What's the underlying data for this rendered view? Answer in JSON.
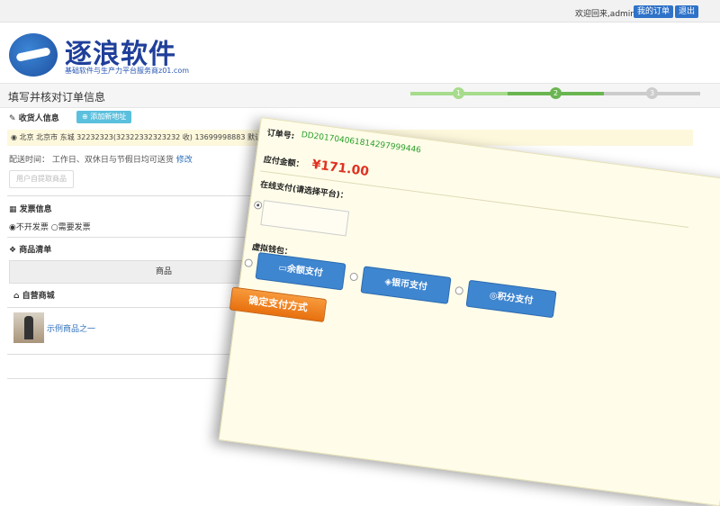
{
  "header": {
    "welcome": "欢迎回来,admin",
    "my_orders": "我的订单",
    "logout": "退出"
  },
  "logo": {
    "title": "逐浪软件",
    "subtitle": "基础软件与生产力平台服务商z01.com"
  },
  "page_title": "填写并核对订单信息",
  "steps": [
    "1",
    "2",
    "3"
  ],
  "consignee": {
    "heading": "收货人信息",
    "add_address": "添加新地址",
    "address_line": "北京 北京市 东城 32232323(32322332323232 收) 13699998883 默认地址",
    "shipping_label": "配送时间：",
    "shipping_value": "工作日、双休日与节假日均可送货",
    "shipping_edit": "修改",
    "pickup": "用户自提取商品"
  },
  "invoice": {
    "heading": "发票信息",
    "opt_no": "不开发票",
    "opt_yes": "需要发票"
  },
  "products": {
    "heading": "商品清单",
    "col_product": "商品",
    "shop": "自营商城",
    "item_name": "示例商品之一"
  },
  "payment": {
    "order_no_label": "订单号:",
    "order_no": "DD20170406181429799944​6",
    "amount_label": "应付金额：",
    "amount": "¥171.00",
    "online_label": "在线支付(请选择平台)：",
    "virtual_label": "虚拟钱包：",
    "balance": "余额支付",
    "silver": "银币支付",
    "points": "积分支付",
    "confirm": "确定支付方式"
  },
  "colors": {
    "accent_blue": "#2f72c8",
    "step_done": "#a6dc8c",
    "step_active": "#6ab552",
    "step_todo": "#cccccc",
    "price_red": "#e03020",
    "confirm_orange": "#f08a26"
  }
}
